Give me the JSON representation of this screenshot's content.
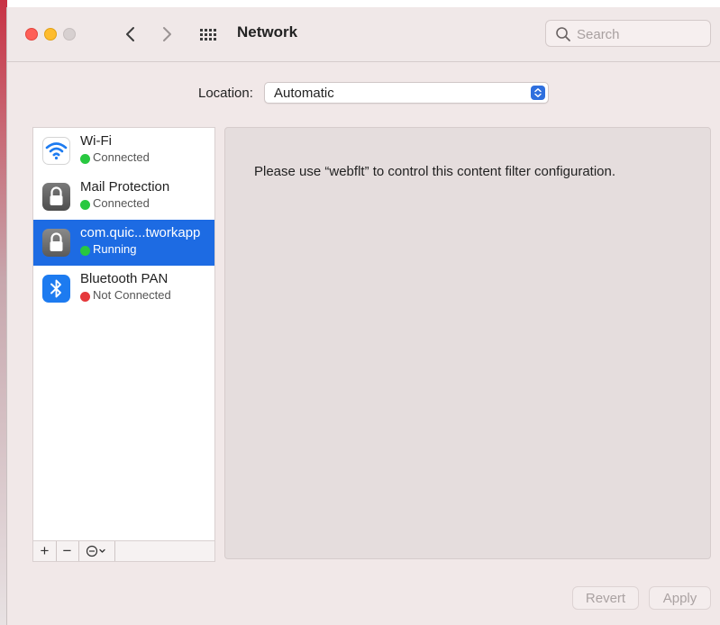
{
  "window": {
    "title": "Network"
  },
  "search": {
    "placeholder": "Search"
  },
  "location": {
    "label": "Location:",
    "value": "Automatic"
  },
  "services": [
    {
      "name": "Wi-Fi",
      "status": "Connected",
      "status_color": "#28c840",
      "icon": "wifi-icon",
      "selected": false
    },
    {
      "name": "Mail Protection",
      "status": "Connected",
      "status_color": "#28c840",
      "icon": "lock-icon",
      "selected": false
    },
    {
      "name": "com.quic...tworkapp",
      "status": "Running",
      "status_color": "#28c840",
      "icon": "lock-icon",
      "selected": true
    },
    {
      "name": "Bluetooth PAN",
      "status": "Not Connected",
      "status_color": "#e5383b",
      "icon": "bluetooth-icon",
      "selected": false
    }
  ],
  "sidebar_toolbar": {
    "add": "+",
    "remove": "−"
  },
  "content": {
    "message": "Please use “webflt” to control this content filter configuration."
  },
  "footer": {
    "revert_label": "Revert",
    "apply_label": "Apply"
  },
  "colors": {
    "accent": "#1d6be3",
    "connected": "#28c840",
    "disconnected": "#e5383b"
  }
}
